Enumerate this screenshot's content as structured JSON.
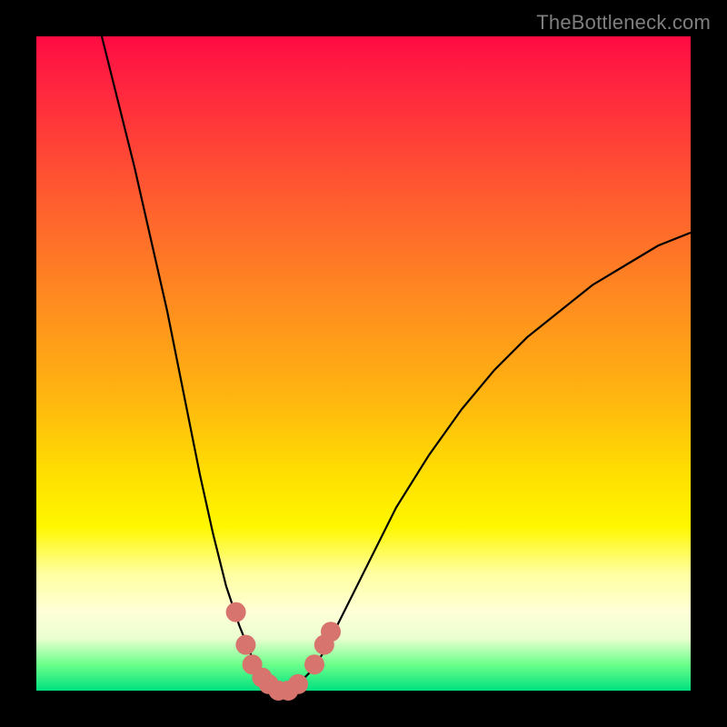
{
  "attribution": "TheBottleneck.com",
  "chart_data": {
    "type": "line",
    "title": "",
    "xlabel": "",
    "ylabel": "",
    "ylim": [
      0,
      100
    ],
    "xlim": [
      0,
      100
    ],
    "series": [
      {
        "name": "bottleneck-curve",
        "x": [
          10,
          15,
          20,
          25,
          27,
          29,
          31,
          33,
          34,
          35,
          36,
          37,
          38,
          39,
          40,
          42,
          44,
          46,
          50,
          55,
          60,
          65,
          70,
          75,
          80,
          85,
          90,
          95,
          100
        ],
        "y": [
          100,
          80,
          58,
          33,
          24,
          16,
          10,
          5,
          3,
          2,
          1,
          0,
          0,
          0,
          1,
          3,
          6,
          10,
          18,
          28,
          36,
          43,
          49,
          54,
          58,
          62,
          65,
          68,
          70
        ]
      }
    ],
    "markers": {
      "name": "highlight-dots",
      "color": "#d7746d",
      "points": [
        {
          "x": 30.5,
          "y": 12
        },
        {
          "x": 32.0,
          "y": 7
        },
        {
          "x": 33.0,
          "y": 4
        },
        {
          "x": 34.5,
          "y": 2
        },
        {
          "x": 35.5,
          "y": 1
        },
        {
          "x": 37.0,
          "y": 0
        },
        {
          "x": 38.5,
          "y": 0
        },
        {
          "x": 40.0,
          "y": 1
        },
        {
          "x": 42.5,
          "y": 4
        },
        {
          "x": 44.0,
          "y": 7
        },
        {
          "x": 45.0,
          "y": 9
        }
      ]
    }
  }
}
